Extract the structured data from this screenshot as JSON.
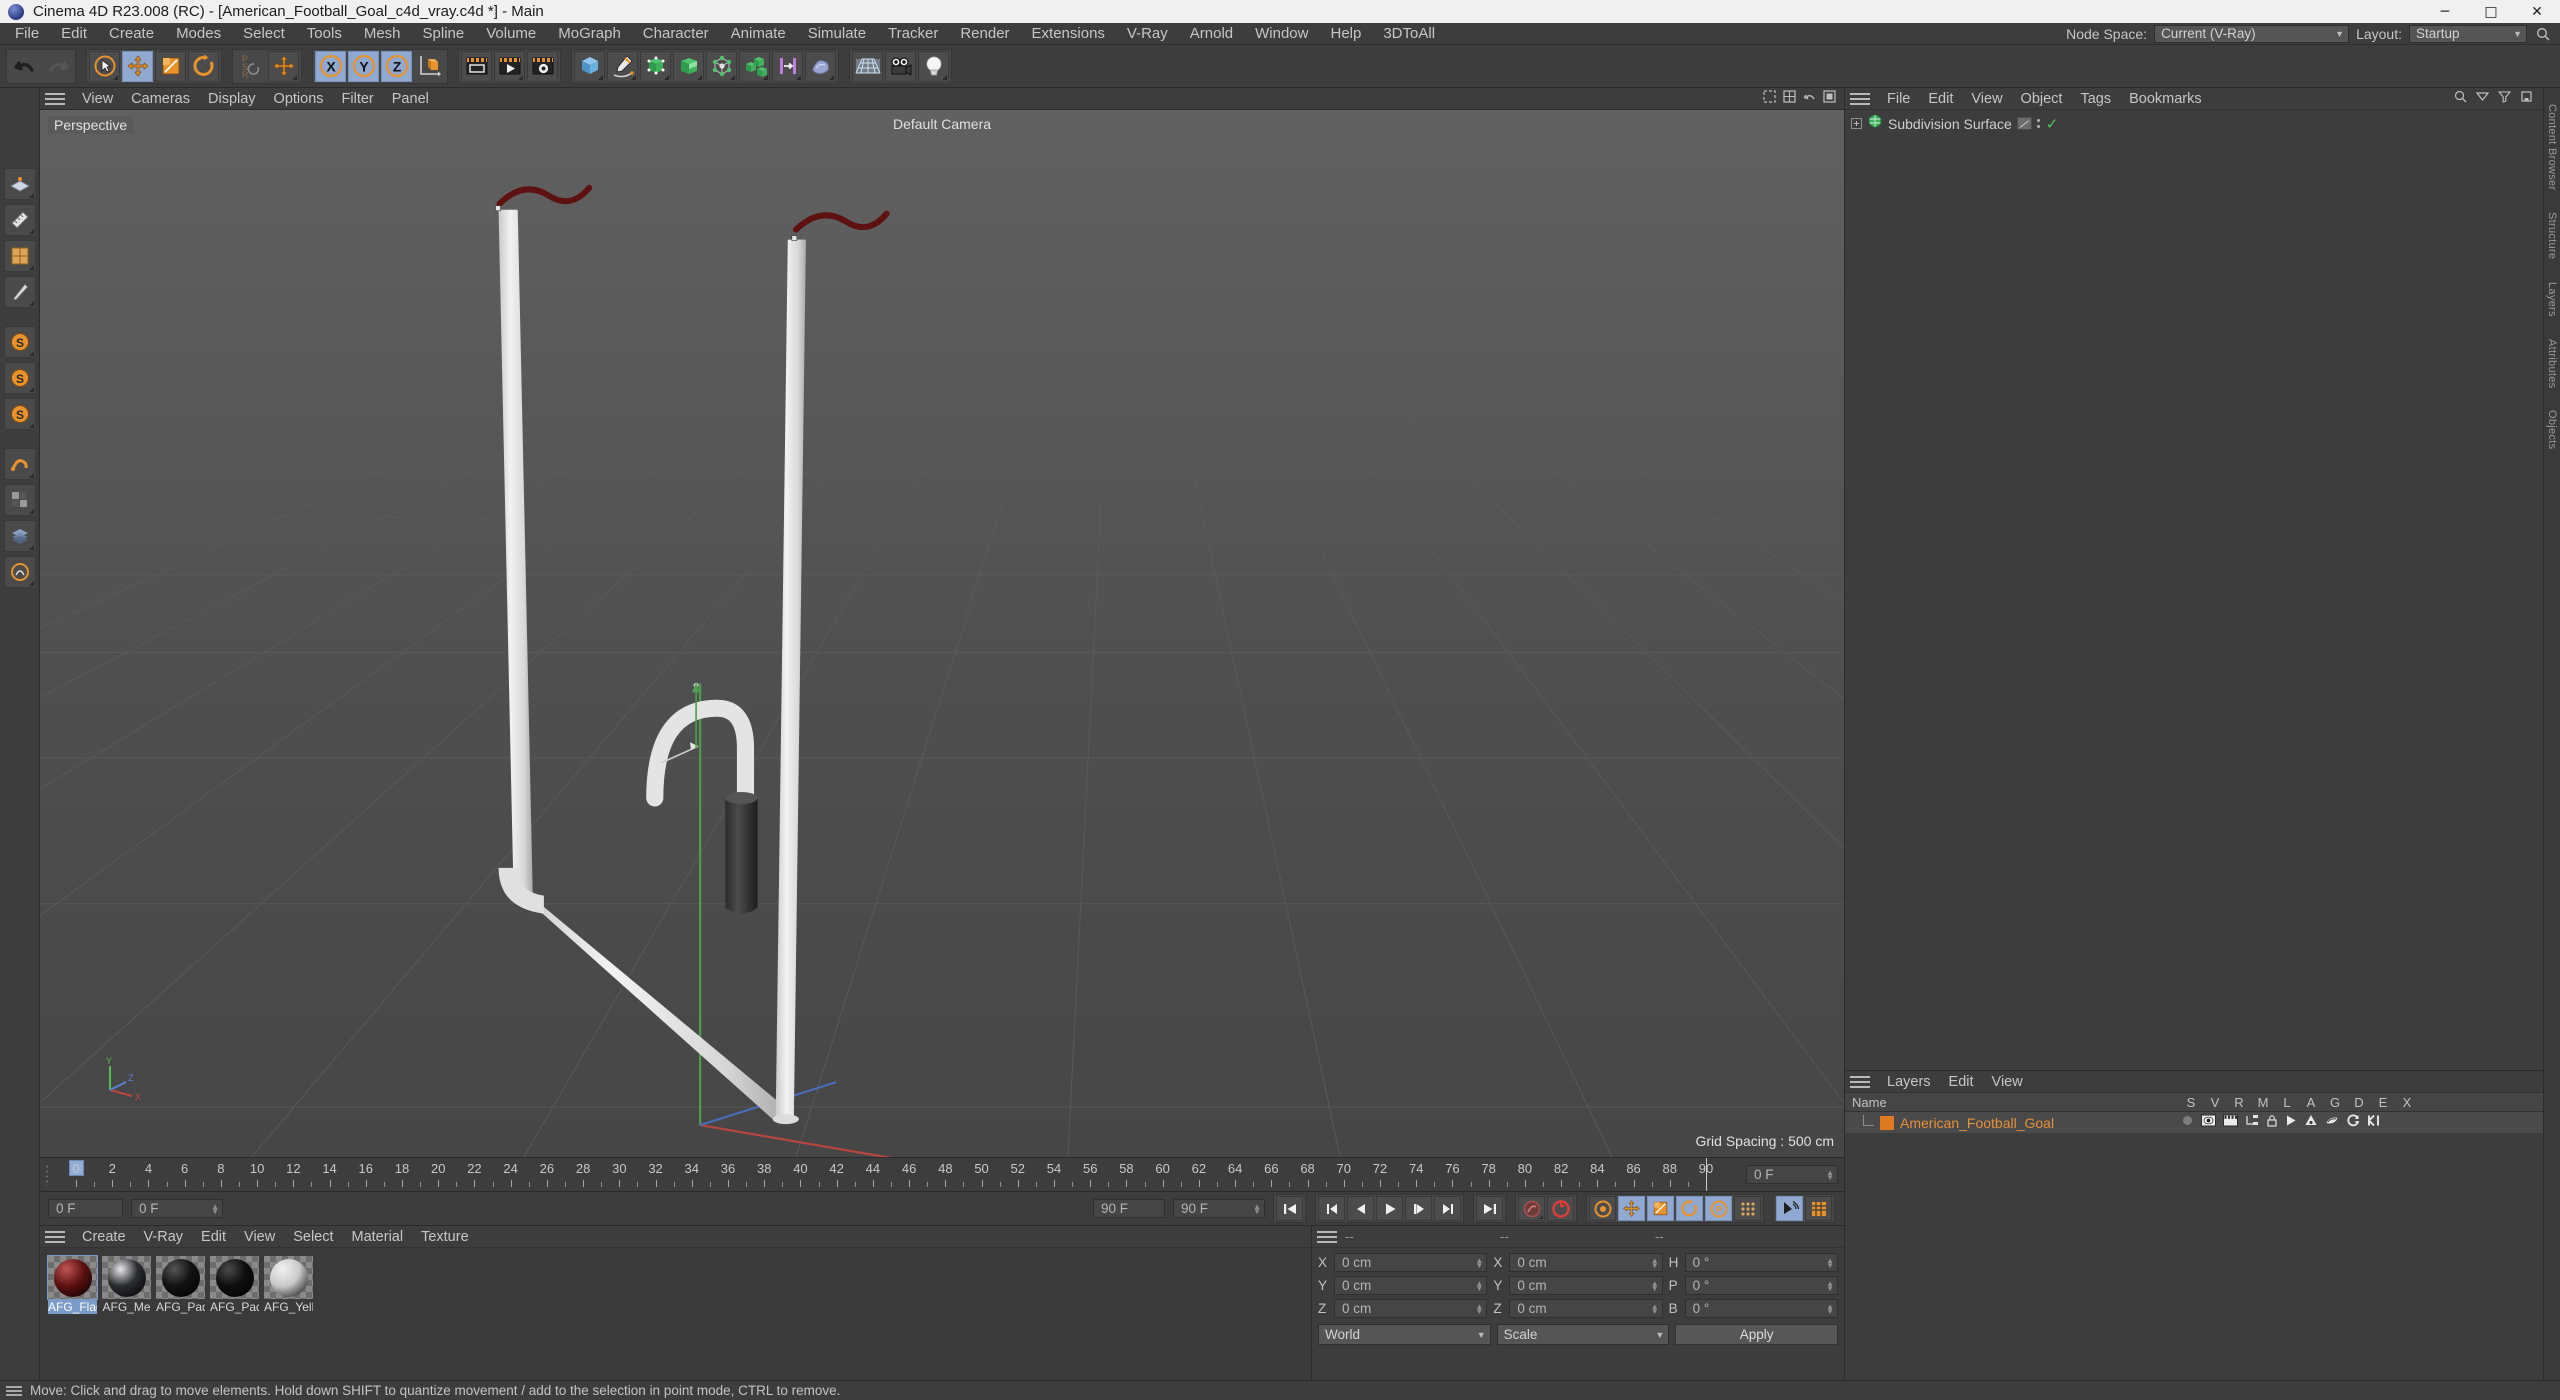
{
  "window": {
    "title": "Cinema 4D R23.008 (RC) - [American_Football_Goal_c4d_vray.c4d *] - Main",
    "minimize": "─",
    "maximize": "□",
    "close": "✕"
  },
  "menubar": {
    "items": [
      "File",
      "Edit",
      "Create",
      "Modes",
      "Select",
      "Tools",
      "Mesh",
      "Spline",
      "Volume",
      "MoGraph",
      "Character",
      "Animate",
      "Simulate",
      "Tracker",
      "Render",
      "Extensions",
      "V-Ray",
      "Arnold",
      "Window",
      "Help",
      "3DToAll"
    ],
    "node_space_label": "Node Space:",
    "node_space_value": "Current (V-Ray)",
    "layout_label": "Layout:",
    "layout_value": "Startup",
    "search_icon": "search-icon"
  },
  "toolbar": {
    "groups": [
      {
        "name": "history",
        "buttons": [
          {
            "icon": "undo-icon",
            "active": false
          },
          {
            "icon": "redo-icon",
            "active": false,
            "disabled": true
          }
        ]
      },
      {
        "name": "transform",
        "buttons": [
          {
            "icon": "live-selection-icon",
            "active": false
          },
          {
            "icon": "move-tool-icon",
            "active": true
          },
          {
            "icon": "scale-tool-icon",
            "active": false
          },
          {
            "icon": "rotate-tool-icon",
            "active": false
          }
        ]
      },
      {
        "name": "psr",
        "buttons": [
          {
            "icon": "psr-lock-icon",
            "active": false
          },
          {
            "icon": "move-axis-icon",
            "active": false
          }
        ]
      },
      {
        "name": "axes",
        "buttons": [
          {
            "icon": "x-axis-icon",
            "active": true
          },
          {
            "icon": "y-axis-icon",
            "active": true
          },
          {
            "icon": "z-axis-icon",
            "active": true
          },
          {
            "icon": "world-coordinate-icon",
            "active": false
          }
        ]
      },
      {
        "name": "render",
        "buttons": [
          {
            "icon": "render-view-icon",
            "active": false
          },
          {
            "icon": "render-queue-icon",
            "active": false
          },
          {
            "icon": "render-settings-icon",
            "active": false
          }
        ]
      },
      {
        "name": "primitives",
        "buttons": [
          {
            "icon": "cube-primitive-icon",
            "active": false
          },
          {
            "icon": "pen-spline-icon",
            "active": false
          },
          {
            "icon": "nurbs-icon",
            "active": false
          },
          {
            "icon": "array-icon",
            "active": false
          },
          {
            "icon": "deformer-icon",
            "active": false
          },
          {
            "icon": "mograph-cloner-icon",
            "active": false
          },
          {
            "icon": "hair-icon",
            "active": false
          },
          {
            "icon": "sculpt-icon",
            "active": false
          }
        ]
      },
      {
        "name": "scene",
        "buttons": [
          {
            "icon": "floor-icon",
            "active": false
          },
          {
            "icon": "camera-icon",
            "active": false
          },
          {
            "icon": "light-icon",
            "active": false
          }
        ]
      }
    ]
  },
  "left_toolbar": {
    "buttons": [
      "live-selection-icon",
      "move-tool-icon",
      "scale-tool-icon",
      "rotate-tool-icon",
      "workplane-icon",
      "measure-icon",
      "subdivide-icon",
      "knife-icon",
      "extrude-icon",
      "texture-axis-icon",
      "uv-icon",
      "snap-icon"
    ]
  },
  "viewport": {
    "menu": [
      "View",
      "Cameras",
      "Display",
      "Options",
      "Filter",
      "Panel"
    ],
    "projection_label": "Perspective",
    "camera_label": "Default Camera",
    "grid_spacing": "Grid Spacing : 500 cm",
    "axis_labels": {
      "x": "X",
      "y": "Y",
      "z": "Z"
    },
    "icons": [
      "viewport-render-region-icon",
      "viewport-layout-icon",
      "viewport-undo-icon",
      "viewport-maximize-icon"
    ]
  },
  "object_manager": {
    "menu": [
      "File",
      "Edit",
      "View",
      "Object",
      "Tags",
      "Bookmarks"
    ],
    "icons": [
      "search-icon",
      "filter-icon",
      "funnel-icon",
      "bookmark-icon"
    ],
    "objects": [
      {
        "name": "Subdivision Surface",
        "expandable": true,
        "icon": "subdivision-surface-icon",
        "tag": "display-tag-icon",
        "enabled": "✓"
      }
    ]
  },
  "layers": {
    "menu": [
      "Layers",
      "Edit",
      "View"
    ],
    "columns": [
      "Name",
      "S",
      "V",
      "R",
      "M",
      "L",
      "A",
      "G",
      "D",
      "E",
      "X"
    ],
    "rows": [
      {
        "name": "American_Football_Goal",
        "color": "#e07a22",
        "icons": [
          "solo-dot-icon",
          "visible-eye-icon",
          "render-icon",
          "manager-icon",
          "lock-icon",
          "animation-icon",
          "generator-icon",
          "deformer-icon",
          "expression-icon",
          "xpresso-icon"
        ]
      }
    ]
  },
  "right_edge_tabs": [
    "Content Browser",
    "Structure",
    "Layers",
    "Attributes",
    "Objects"
  ],
  "timeline": {
    "start_frame": "0 F",
    "end_frame": "90 F",
    "current_frame": "0 F",
    "preview_end": "90 F",
    "min": 0,
    "max": 90,
    "labels": [
      0,
      2,
      4,
      6,
      8,
      10,
      12,
      14,
      16,
      18,
      20,
      22,
      24,
      26,
      28,
      30,
      32,
      34,
      36,
      38,
      40,
      42,
      44,
      46,
      48,
      50,
      52,
      54,
      56,
      58,
      60,
      62,
      64,
      66,
      68,
      70,
      72,
      74,
      76,
      78,
      80,
      82,
      84,
      86,
      88,
      90
    ],
    "playhead": 0
  },
  "playback": {
    "buttons": [
      {
        "icon": "go-to-start-icon",
        "active": false
      },
      {
        "icon": "previous-keyframe-icon",
        "active": false
      },
      {
        "icon": "step-back-icon",
        "active": false
      },
      {
        "icon": "play-icon",
        "active": false
      },
      {
        "icon": "step-forward-icon",
        "active": false
      },
      {
        "icon": "next-keyframe-icon",
        "active": false
      },
      {
        "icon": "go-to-end-icon",
        "active": false
      },
      {
        "icon": "record-active-objects-icon",
        "active": false
      },
      {
        "icon": "autokeying-icon",
        "active": false
      },
      {
        "icon": "keyframe-selection-icon",
        "active": false
      },
      {
        "icon": "position-key-icon",
        "active": true
      },
      {
        "icon": "scale-key-icon",
        "active": true
      },
      {
        "icon": "rotation-key-icon",
        "active": true
      },
      {
        "icon": "parameter-key-icon",
        "active": true
      },
      {
        "icon": "point-level-animation-icon",
        "active": false
      },
      {
        "icon": "motion-clip-icon",
        "active": true
      },
      {
        "icon": "timeline-icon",
        "active": false
      }
    ]
  },
  "materials": {
    "menu": [
      "Create",
      "V-Ray",
      "Edit",
      "View",
      "Select",
      "Material",
      "Texture"
    ],
    "items": [
      {
        "name": "AFG_Flag",
        "color": "#5e1111",
        "highlight": "#c05555",
        "selected": true
      },
      {
        "name": "AFG_Me",
        "color": "#2a2c30",
        "highlight": "#e8e8ea",
        "selected": false
      },
      {
        "name": "AFG_Pad",
        "color": "#121212",
        "highlight": "#555555",
        "selected": false
      },
      {
        "name": "AFG_Pad",
        "color": "#0e0e0e",
        "highlight": "#4a4a4a",
        "selected": false
      },
      {
        "name": "AFG_Yell",
        "color": "#c9c9c9",
        "highlight": "#f2f2f2",
        "selected": false
      }
    ]
  },
  "coordinates": {
    "headers": [
      "--",
      "--",
      "--"
    ],
    "position": {
      "labels": [
        "X",
        "Y",
        "Z"
      ],
      "values": [
        "0 cm",
        "0 cm",
        "0 cm"
      ]
    },
    "size": {
      "labels": [
        "X",
        "Y",
        "Z"
      ],
      "values": [
        "0 cm",
        "0 cm",
        "0 cm"
      ]
    },
    "rotation": {
      "labels": [
        "H",
        "P",
        "B"
      ],
      "values": [
        "0 °",
        "0 °",
        "0 °"
      ]
    },
    "system": "World",
    "mode": "Scale",
    "apply": "Apply"
  },
  "statusbar": {
    "text": "Move: Click and drag to move elements. Hold down SHIFT to quantize movement / add to the selection in point mode, CTRL to remove."
  },
  "colors": {
    "accent_orange": "#e8922c",
    "active_blue": "#8fa9d0",
    "layer_orange": "#e07a22",
    "panel_bg": "#3d3d3d",
    "viewport_bg": "#555555"
  }
}
